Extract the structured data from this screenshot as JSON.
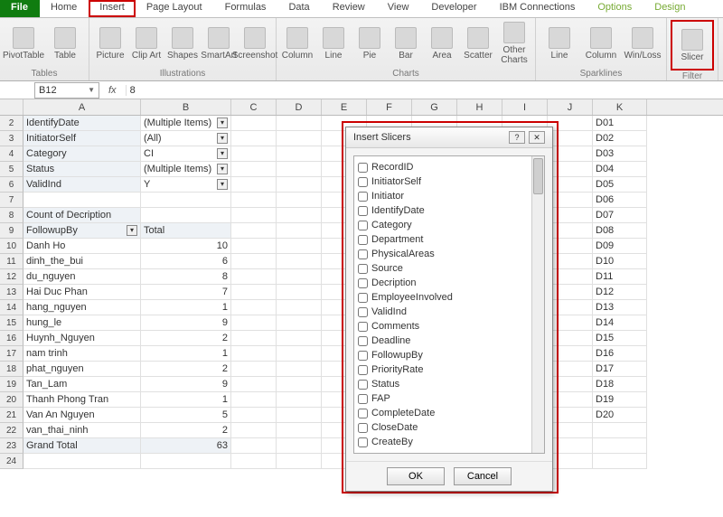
{
  "tabs": [
    "File",
    "Home",
    "Insert",
    "Page Layout",
    "Formulas",
    "Data",
    "Review",
    "View",
    "Developer",
    "IBM Connections",
    "Options",
    "Design"
  ],
  "ribbon": {
    "groups": [
      {
        "label": "Tables",
        "buttons": [
          "PivotTable",
          "Table"
        ]
      },
      {
        "label": "Illustrations",
        "buttons": [
          "Picture",
          "Clip Art",
          "Shapes",
          "SmartArt",
          "Screenshot"
        ]
      },
      {
        "label": "Charts",
        "buttons": [
          "Column",
          "Line",
          "Pie",
          "Bar",
          "Area",
          "Scatter",
          "Other Charts"
        ]
      },
      {
        "label": "Sparklines",
        "buttons": [
          "Line",
          "Column",
          "Win/Loss"
        ]
      },
      {
        "label": "Filter",
        "buttons": [
          "Slicer"
        ]
      }
    ]
  },
  "namebox": "B12",
  "fxvalue": "8",
  "columns": [
    "A",
    "B",
    "C",
    "D",
    "E",
    "F",
    "G",
    "H",
    "I",
    "J",
    "K"
  ],
  "row_start": 2,
  "row_end": 24,
  "filter_rows": [
    {
      "label": "IdentifyDate",
      "value": "(Multiple Items)",
      "filter": true
    },
    {
      "label": "InitiatorSelf",
      "value": "(All)",
      "filter": true
    },
    {
      "label": "Category",
      "value": "CI",
      "filter": true
    },
    {
      "label": "Status",
      "value": "(Multiple Items)",
      "filter": true
    },
    {
      "label": "ValidInd",
      "value": "Y",
      "filter": true
    }
  ],
  "pivot_header": {
    "a": "Count of Decription"
  },
  "pivot_labels": {
    "a": "FollowupBy",
    "b": "Total"
  },
  "pivot_rows": [
    {
      "name": "Danh Ho",
      "val": 10
    },
    {
      "name": "dinh_the_bui",
      "val": 6
    },
    {
      "name": "du_nguyen",
      "val": 8
    },
    {
      "name": "Hai Duc Phan",
      "val": 7
    },
    {
      "name": "hang_nguyen",
      "val": 1
    },
    {
      "name": "hung_le",
      "val": 9
    },
    {
      "name": "Huynh_Nguyen",
      "val": 2
    },
    {
      "name": "nam trinh",
      "val": 1
    },
    {
      "name": "phat_nguyen",
      "val": 2
    },
    {
      "name": "Tan_Lam",
      "val": 9
    },
    {
      "name": "Thanh Phong Tran",
      "val": 1
    },
    {
      "name": "Van An Nguyen",
      "val": 5
    },
    {
      "name": "van_thai_ninh",
      "val": 2
    }
  ],
  "grand_total": {
    "label": "Grand Total",
    "val": 63
  },
  "k_col": [
    "D01",
    "D02",
    "D03",
    "D04",
    "D05",
    "D06",
    "D07",
    "D08",
    "D09",
    "D10",
    "D11",
    "D12",
    "D13",
    "D14",
    "D15",
    "D16",
    "D17",
    "D18",
    "D19",
    "D20"
  ],
  "dialog": {
    "title": "Insert Slicers",
    "items": [
      "RecordID",
      "InitiatorSelf",
      "Initiator",
      "IdentifyDate",
      "Category",
      "Department",
      "PhysicalAreas",
      "Source",
      "Decription",
      "EmployeeInvolved",
      "ValidInd",
      "Comments",
      "Deadline",
      "FollowupBy",
      "PriorityRate",
      "Status",
      "FAP",
      "CompleteDate",
      "CloseDate",
      "CreateBy"
    ],
    "ok": "OK",
    "cancel": "Cancel"
  }
}
